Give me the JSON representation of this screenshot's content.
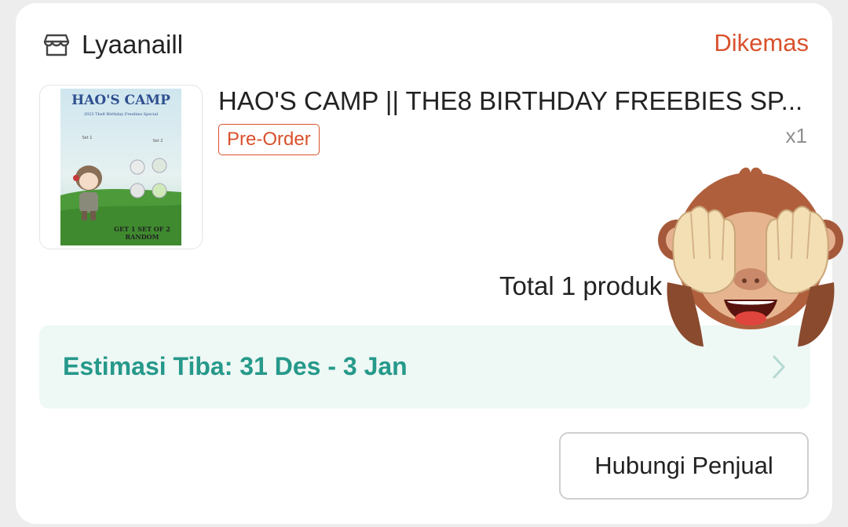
{
  "shop": {
    "name": "Lyaanaill",
    "icon": "store-icon"
  },
  "order": {
    "status": "Dikemas"
  },
  "product": {
    "title": "HAO'S CAMP || THE8 BIRTHDAY FREEBIES SP...",
    "badge": "Pre-Order",
    "quantity": "x1",
    "thumbnail": {
      "heading": "HAO'S CAMP",
      "subheading": "2023 The8 Birthday Freebies Special",
      "set1_label": "Set 1",
      "set2_label": "Set 2",
      "footer_line1": "GET 1 SET OF 2",
      "footer_line2": "RANDOM"
    }
  },
  "summary": {
    "total_text": "Total 1 produk"
  },
  "shipping": {
    "eta_text": "Estimasi Tiba: 31 Des - 3 Jan",
    "icon": "chevron-right-icon"
  },
  "actions": {
    "contact_seller_label": "Hubungi Penjual"
  },
  "overlay": {
    "icon": "see-no-evil-monkey-icon"
  },
  "colors": {
    "accent_orange": "#d9512c",
    "eta_green": "#26998a",
    "eta_background": "#eef8f5"
  }
}
